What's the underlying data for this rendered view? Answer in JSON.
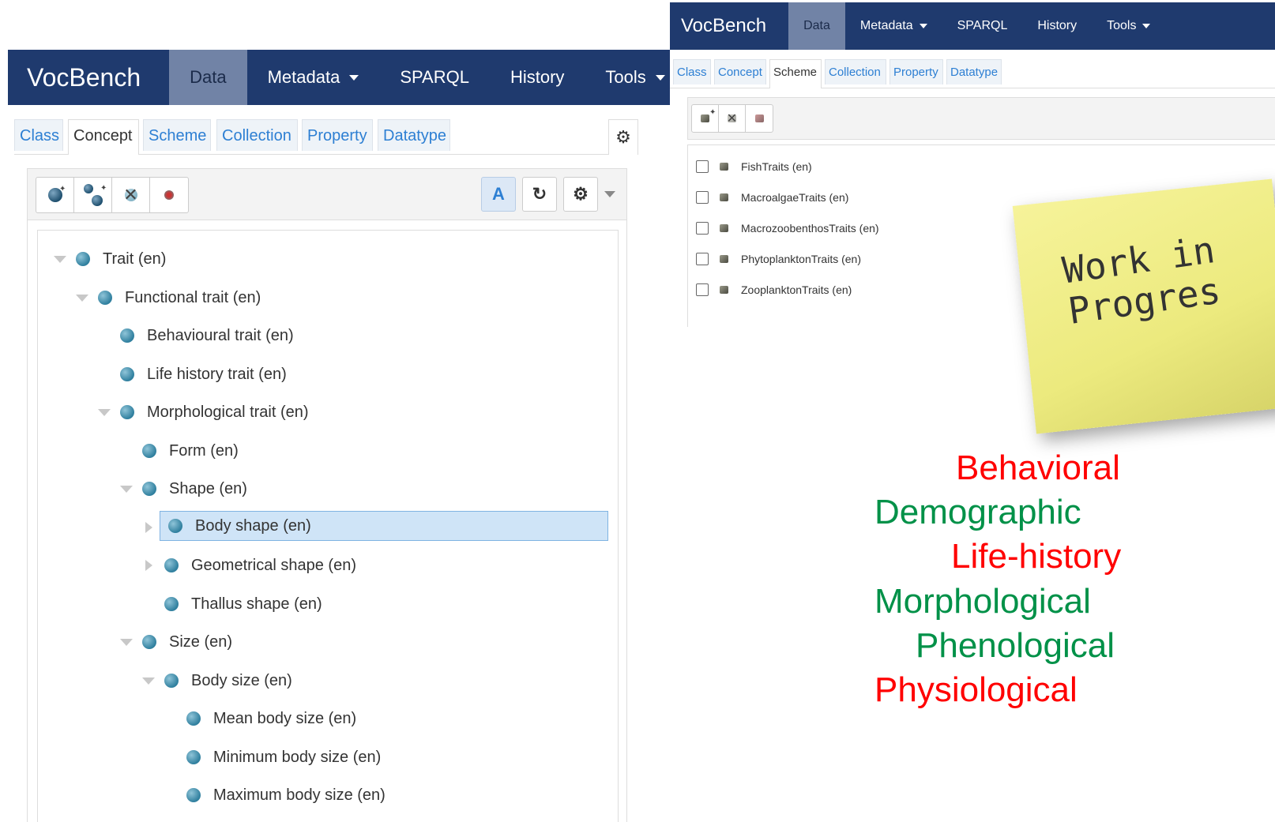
{
  "left": {
    "navbar": {
      "brand": "VocBench",
      "items": [
        {
          "label": "Data"
        },
        {
          "label": "Metadata"
        },
        {
          "label": "SPARQL"
        },
        {
          "label": "History"
        },
        {
          "label": "Tools"
        }
      ]
    },
    "tabs": [
      "Class",
      "Concept",
      "Scheme",
      "Collection",
      "Property",
      "Datatype"
    ],
    "active_tab": "Concept",
    "toolbar": {
      "lang_button": "A",
      "refresh_icon": "refresh-icon",
      "settings_icon": "gear-icon"
    },
    "tree": [
      {
        "label": "Trait (en)",
        "expanded": true
      },
      {
        "label": "Functional trait (en)",
        "expanded": true
      },
      {
        "label": "Behavioural trait (en)"
      },
      {
        "label": "Life history trait (en)"
      },
      {
        "label": "Morphological trait (en)",
        "expanded": true
      },
      {
        "label": "Form (en)"
      },
      {
        "label": "Shape (en)",
        "expanded": true
      },
      {
        "label": "Body shape (en)",
        "collapsed": true,
        "selected": true
      },
      {
        "label": "Geometrical shape (en)",
        "collapsed": true
      },
      {
        "label": "Thallus shape (en)"
      },
      {
        "label": "Size (en)",
        "expanded": true
      },
      {
        "label": "Body size (en)",
        "expanded": true
      },
      {
        "label": "Mean body size (en)"
      },
      {
        "label": "Minimum body size (en)"
      },
      {
        "label": "Maximum body size (en)"
      }
    ]
  },
  "right": {
    "navbar": {
      "brand": "VocBench",
      "items": [
        {
          "label": "Data"
        },
        {
          "label": "Metadata"
        },
        {
          "label": "SPARQL"
        },
        {
          "label": "History"
        },
        {
          "label": "Tools"
        }
      ]
    },
    "tabs": [
      "Class",
      "Concept",
      "Scheme",
      "Collection",
      "Property",
      "Datatype"
    ],
    "active_tab": "Scheme",
    "schemes": [
      "FishTraits (en)",
      "MacroalgaeTraits (en)",
      "MacrozoobenthosTraits (en)",
      "PhytoplanktonTraits (en)",
      "ZooplanktonTraits (en)"
    ]
  },
  "sticky_note": {
    "line1": "Work in",
    "line2": "Progres"
  },
  "trait_types": [
    {
      "label": "Behavioral",
      "color": "#ff0000"
    },
    {
      "label": "Demographic",
      "color": "#009148"
    },
    {
      "label": "Life-history",
      "color": "#ff0000"
    },
    {
      "label": "Morphological",
      "color": "#009148"
    },
    {
      "label": "Phenological",
      "color": "#009148"
    },
    {
      "label": "Physiological",
      "color": "#ff0000"
    }
  ],
  "colors": {
    "navbar": "#1f3a6e",
    "nav_active": "#7183a6",
    "link": "#2d7fd3",
    "selected_row": "#cfe4f7"
  }
}
